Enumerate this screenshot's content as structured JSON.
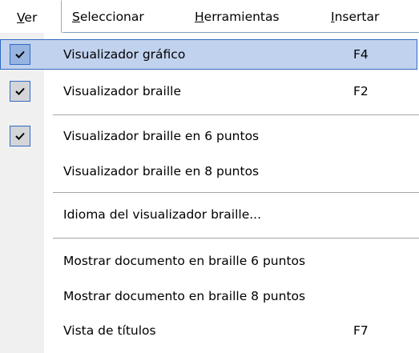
{
  "menubar": {
    "items": [
      {
        "mnemonic": "V",
        "rest": "er"
      },
      {
        "mnemonic": "S",
        "rest": "eleccionar"
      },
      {
        "mnemonic": "H",
        "rest": "erramientas"
      },
      {
        "mnemonic": "I",
        "rest": "nsertar"
      }
    ]
  },
  "menu": {
    "items": [
      {
        "label": "Visualizador gráfico",
        "shortcut": "F4",
        "checked": true,
        "highlighted": true
      },
      {
        "label": "Visualizador braille",
        "shortcut": "F2",
        "checked": true,
        "highlighted": false
      },
      {
        "label": "Visualizador braille en 6 puntos",
        "shortcut": "",
        "checked": true,
        "highlighted": false
      },
      {
        "label": "Visualizador braille en 8 puntos",
        "shortcut": "",
        "checked": false,
        "highlighted": false
      },
      {
        "label": "Idioma del visualizador braille...",
        "shortcut": "",
        "checked": false,
        "highlighted": false
      },
      {
        "label": "Mostrar documento en braille 6 puntos",
        "shortcut": "",
        "checked": false,
        "highlighted": false
      },
      {
        "label": "Mostrar documento en braille 8 puntos",
        "shortcut": "",
        "checked": false,
        "highlighted": false
      },
      {
        "label": "Vista de títulos",
        "shortcut": "F7",
        "checked": false,
        "highlighted": false
      }
    ]
  },
  "colors": {
    "highlight_fill": "#c1d2ee",
    "highlight_border": "#316ac5",
    "check_fill": "#d4d5d8",
    "icon_column": "#f0f0f0"
  },
  "icons": {
    "check": "check-mark-icon"
  }
}
